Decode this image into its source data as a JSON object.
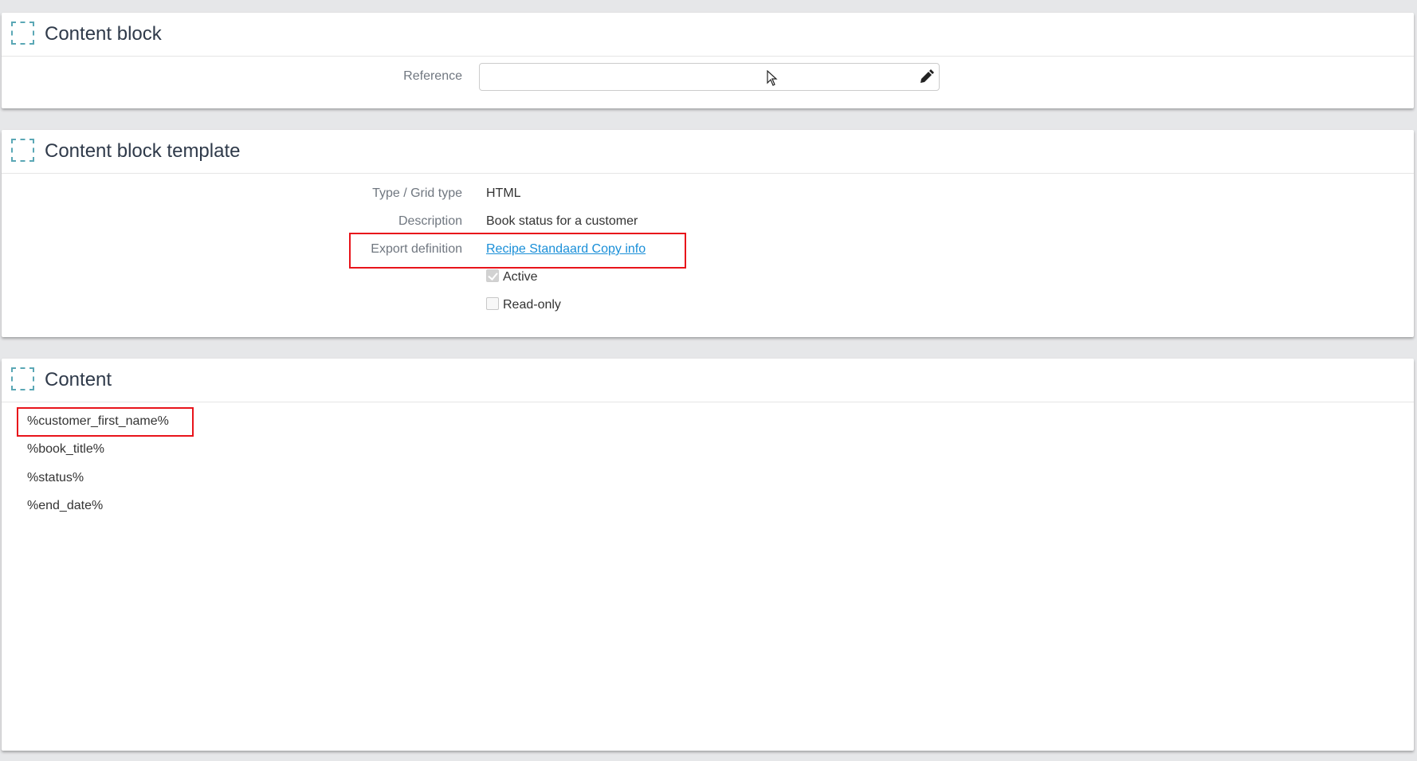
{
  "content_block": {
    "title": "Content block",
    "reference_label": "Reference",
    "reference_value": "",
    "reference_placeholder": "",
    "edit_icon": "pencil-icon"
  },
  "template": {
    "title": "Content block template",
    "fields": {
      "type_label": "Type / Grid type",
      "type_value": "HTML",
      "description_label": "Description",
      "description_value": "Book status for a customer",
      "export_label": "Export definition",
      "export_value": "Recipe Standaard Copy info"
    },
    "active_label": "Active",
    "active_checked": true,
    "readonly_label": "Read-only",
    "readonly_checked": false
  },
  "content": {
    "title": "Content",
    "items": [
      "%customer_first_name%",
      "%book_title%",
      "%status%",
      "%end_date%"
    ]
  },
  "colors": {
    "highlight": "#e8141b",
    "link": "#1a8fd8",
    "section_icon": "#5aa7b5"
  }
}
